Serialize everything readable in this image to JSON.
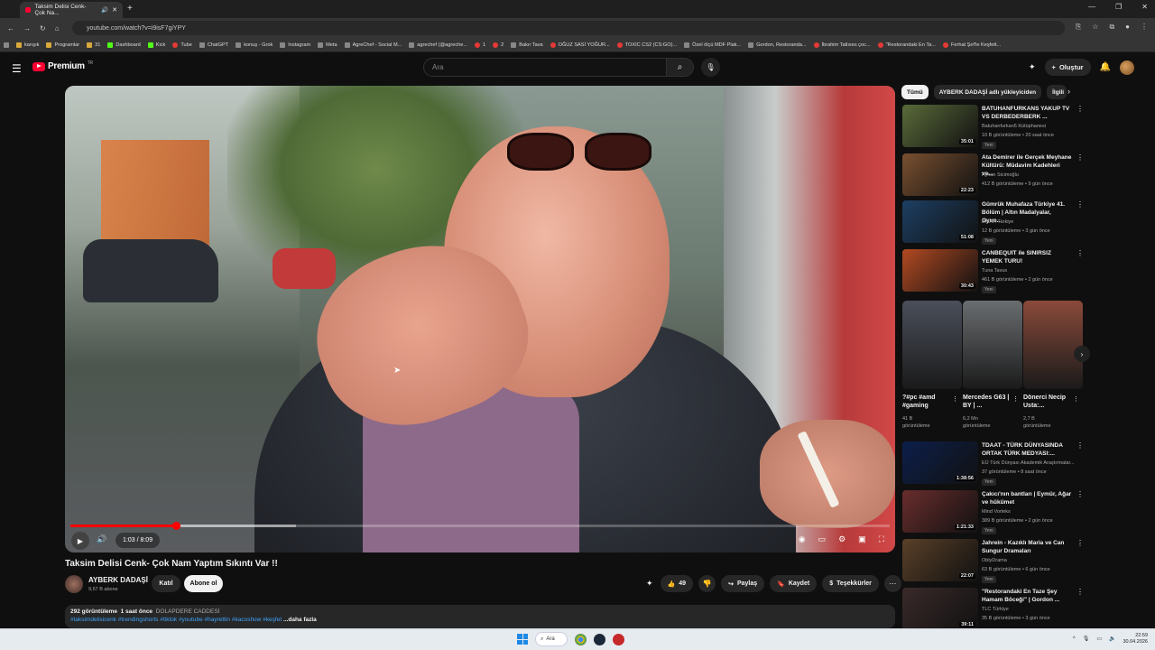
{
  "browser": {
    "tab_title": "Taksim Delisi Cenk- Çok Na...",
    "url": "youtube.com/watch?v=i9isF7giYPY",
    "bookmarks": [
      "karışık",
      "Programlar",
      "31",
      "Dashboard",
      "Kick",
      "Tube",
      "ChatGPT",
      "konuş - Grok",
      "Instagram",
      "Meta",
      "AgreChef - Social M...",
      "agrechef (@agreche...",
      "1",
      "2",
      "Bakır Tava",
      "OĞUZ SASİ YOĞUR...",
      "TOXIC CS2 (CS:GO)...",
      "Özel ölçü MDF Plak...",
      "Gordon, Restoranda...",
      "İbrahim Tatlıses çoc...",
      "\"Restorandaki En Ta...",
      "Ferhat Şef'le Keşfett..."
    ]
  },
  "header": {
    "logo_text": "Premium",
    "logo_sup": "TR",
    "search_placeholder": "Ara",
    "create_label": "Oluştur"
  },
  "player": {
    "time": "1:03 / 8:09",
    "progress_played": 0.129,
    "progress_buffered": 0.275
  },
  "video": {
    "title": "Taksim Delisi Cenk- Çok Nam Yaptım Sıkıntı Var !!",
    "channel": "AYBERK DADAŞİ",
    "subscribers": "9,67 B abone",
    "join_label": "Katıl",
    "subscribe_label": "Abone ol",
    "likes": "49",
    "share_label": "Paylaş",
    "save_label": "Kaydet",
    "thanks_label": "Teşekkürler",
    "views": "292 görüntüleme",
    "age": "1 saat önce",
    "location": "DOLAPDERE CADDESİ",
    "tags": "#taksimdelisicenk #trendingshorts #tiktok #youtube #hayrettin #kacoshow #keşfet",
    "more_label": "...daha fazla"
  },
  "chips": [
    "Tümü",
    "AYBERK DADAŞİ adlı yükleyiciden",
    "İlgili"
  ],
  "recommendations": [
    {
      "title1": "BATUHANFURKANS YAKUP TV",
      "title2": "VS DERBEDERBERK ...",
      "channel": "Batuhanfurkan5 Kütüphanesi",
      "meta": "10 B görüntüleme • 20 saat önce",
      "badge": "Yeni",
      "duration": "35:01",
      "color": "#5a6b3a"
    },
    {
      "title1": "Ata Demirer ile Gerçek Meyhane",
      "title2": "Kültürü: Müdavim Kadehleri ve...",
      "channel": "Ayhan Sicimoğlu",
      "meta": "412 B görüntüleme • 9 gün önce",
      "badge": "",
      "duration": "22:23",
      "color": "#7a5030"
    },
    {
      "title1": "Gümrük Muhafaza Türkiye 41.",
      "title2": "Bölüm | Altın Madalyalar, Oyun...",
      "channel": "DMAX Türkiye",
      "meta": "12 B görüntüleme • 3 gün önce",
      "badge": "Yeni",
      "duration": "51:08",
      "color": "#1d3f63"
    },
    {
      "title1": "CANBEQUIT ile SINIRSIZ",
      "title2": "YEMEK TURU!",
      "channel": "Tuna Tavus",
      "meta": "461 B görüntüleme • 2 gün önce",
      "badge": "Yeni",
      "duration": "30:43",
      "color": "#b24a22"
    },
    {
      "title1": "TDAAT - TÜRK DÜNYASINDA",
      "title2": "ORTAK TÜRK MEDYASI:...",
      "channel": "EÜ Türk Dünyası Akademik Araştırmalar...",
      "meta": "37 görüntüleme • 8 saat önce",
      "badge": "Yeni",
      "duration": "1:38:56",
      "color": "#0c1e4a"
    },
    {
      "title1": "Çakıcı'nın bantları | Eymür, Ağar",
      "title2": "ve hükümet",
      "channel": "Mind Vorteks",
      "meta": "389 B görüntüleme • 2 gün önce",
      "badge": "Yeni",
      "duration": "1:21:33",
      "color": "#6a2d2d"
    },
    {
      "title1": "Jahrein - Kazıklı Maria ve Can",
      "title2": "Sungur Dramaları",
      "channel": "OblyDrama",
      "meta": "63 B görüntüleme • 6 gün önce",
      "badge": "Yeni",
      "duration": "22:07",
      "color": "#5a4028"
    },
    {
      "title1": "\"Restorandaki En Taze Şey",
      "title2": "Hamam Böceği\" | Gordon ...",
      "channel": "TLC Türkiye",
      "meta": "35 B görüntüleme • 3 gün önce",
      "badge": "",
      "duration": "39:11",
      "color": "#3a2a2a"
    }
  ],
  "shorts": [
    {
      "title": "?#pc #amd #gaming",
      "views1": "41 B",
      "views2": "görüntüleme",
      "color": "#4a4f5a"
    },
    {
      "title": "Mercedes G63 | BY | ...",
      "views1": "6,2 Mn",
      "views2": "görüntüleme",
      "color": "#6a6d70"
    },
    {
      "title": "Dönerci Necip Usta:...",
      "views1": "2,7 B",
      "views2": "görüntüleme",
      "color": "#8a4a3a"
    }
  ],
  "taskbar": {
    "search_label": "Ara",
    "time": "22:59",
    "date": "30.04.2026"
  },
  "colors": {
    "accent": "#ff0033",
    "bg": "#0f0f0f",
    "chip": "#272727",
    "link": "#3ea6ff"
  }
}
